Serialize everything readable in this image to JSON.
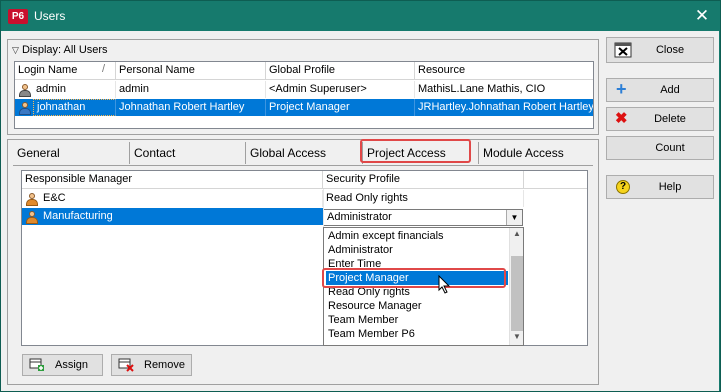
{
  "window": {
    "title": "Users",
    "logo": "P6"
  },
  "users_panel": {
    "display_label": "Display: All Users",
    "columns": [
      "Login Name",
      "Personal Name",
      "Global Profile",
      "Resource"
    ],
    "rows": [
      {
        "login": "admin",
        "personal": "admin",
        "profile": "<Admin Superuser>",
        "resource": "MathisL.Lane Mathis, CIO",
        "selected": false
      },
      {
        "login": "johnathan",
        "personal": "Johnathan Robert Hartley",
        "profile": "Project Manager",
        "resource": "JRHartley.Johnathan Robert Hartley",
        "selected": true
      }
    ]
  },
  "tabs": [
    {
      "label": "General",
      "active": false
    },
    {
      "label": "Contact",
      "active": false
    },
    {
      "label": "Global Access",
      "active": false
    },
    {
      "label": "Project Access",
      "active": true
    },
    {
      "label": "Module Access",
      "active": false
    }
  ],
  "access_grid": {
    "columns": [
      "Responsible Manager",
      "Security Profile"
    ],
    "rows": [
      {
        "manager": "E&C",
        "profile": "Read Only rights",
        "selected": false
      },
      {
        "manager": "Manufacturing",
        "profile": "Administrator",
        "selected": true
      }
    ]
  },
  "dropdown": {
    "value": "Administrator",
    "options": [
      "Admin except financials",
      "Administrator",
      "Enter Time",
      "Project Manager",
      "Read Only rights",
      "Resource Manager",
      "Team Member",
      "Team Member P6"
    ],
    "highlighted": "Project Manager"
  },
  "bottom_buttons": {
    "assign": "Assign",
    "remove": "Remove"
  },
  "side_buttons": {
    "close": "Close",
    "add": "Add",
    "delete": "Delete",
    "count": "Count",
    "help": "Help"
  },
  "colors": {
    "titlebar": "#167a6d",
    "selection": "#0078d7",
    "highlight_box": "#e04848"
  },
  "icons": [
    "p6-logo-icon",
    "close-window-icon",
    "user-admin-icon",
    "user-icon",
    "manager-icon",
    "close-icon",
    "add-icon",
    "delete-icon",
    "help-icon",
    "assign-icon",
    "remove-icon",
    "dropdown-arrow-icon",
    "scroll-up-icon",
    "scroll-down-icon",
    "mouse-cursor-icon"
  ]
}
